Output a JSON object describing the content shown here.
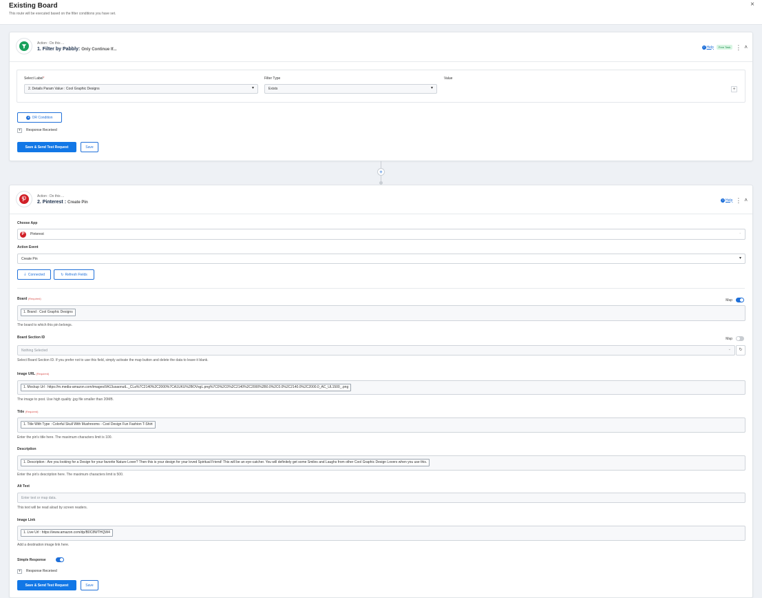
{
  "header": {
    "title": "Existing Board",
    "subtitle": "This route will be executed based on the filter conditions you have set.",
    "close_icon": "×"
  },
  "step1": {
    "pre": "Action : Do this ...",
    "title": "1. Filter by Pabbly",
    "title_suffix": "Only Continue If...",
    "help": "Help",
    "badge": "Free Task",
    "filter": {
      "select_label": "Select Label",
      "select_value": "2. Details Param Value : Cool Graphic Designs",
      "filter_type_label": "Filter Type",
      "filter_type_value": "Exists",
      "value_label": "Value"
    },
    "or_condition": "OR Condition",
    "response_received": "Response Received",
    "save_send": "Save & Send Test Request",
    "save": "Save"
  },
  "step2": {
    "pre": "Action : Do this ...",
    "title": "2. Pinterest",
    "title_suffix": "Create Pin",
    "help": "Help",
    "choose_app_label": "Choose App",
    "choose_app_value": "Pinterest",
    "action_event_label": "Action Event",
    "action_event_value": "Create Pin",
    "connected": "Connected",
    "refresh_fields": "Refresh Fields",
    "required": "(Required)",
    "map_label": "Map",
    "board": {
      "label": "Board",
      "chip": "1. Brand : Cool Graphic Designs",
      "help": "The board to which this pin belongs."
    },
    "board_section": {
      "label": "Board Section ID",
      "value": "Nothing Selected",
      "help": "Select Board Section ID. If you prefer not to use this field, simply activate the map button and delete the data to leave it blank."
    },
    "image_url": {
      "label": "Image URL",
      "chip": "1. Mockup Url : https://m.media-amazon.com/images/I/A13usaonutL._CLa%7C2140%2C2000%7CA1UKU%2BOVsgL.png%7C0%2C0%2C2140%2C2000%2B0.0%2C0.0%2C2140.0%2C2000.0_AC_UL1500_.png",
      "help": "The image to post. Use high quality .jpg file smaller than 20MB."
    },
    "title_field": {
      "label": "Title",
      "chip": "1. Title With Type : Colorful Skull With Mushrooms - Cool Design Fun Fashion T-Shirt",
      "help": "Enter the pin's title here. The maximum characters limit is 100."
    },
    "description": {
      "label": "Description",
      "chip": "1. Description : Are you looking for a Design for your favorite Nature Lover? Then this is your design for your loved Spiritual Friend! This will be an eye-catcher. You will definitely get some Smiles and Laughs from other Cool Graphic Design Lovers when you use this.",
      "help": "Enter the pin's description here. The maximum characters limit is 500."
    },
    "alt_text": {
      "label": "Alt Text",
      "placeholder": "Enter text or map data.",
      "help": "This text will be read aloud by screen readers."
    },
    "image_link": {
      "label": "Image Link",
      "chip": "1. Live Url : https://www.amazon.com/dp/B0C8WTHQW4",
      "help": "Add a destination image link here."
    },
    "simple_response": "Simple Response",
    "response_received": "Response Received",
    "save_send": "Save & Send Test Request",
    "save": "Save"
  }
}
